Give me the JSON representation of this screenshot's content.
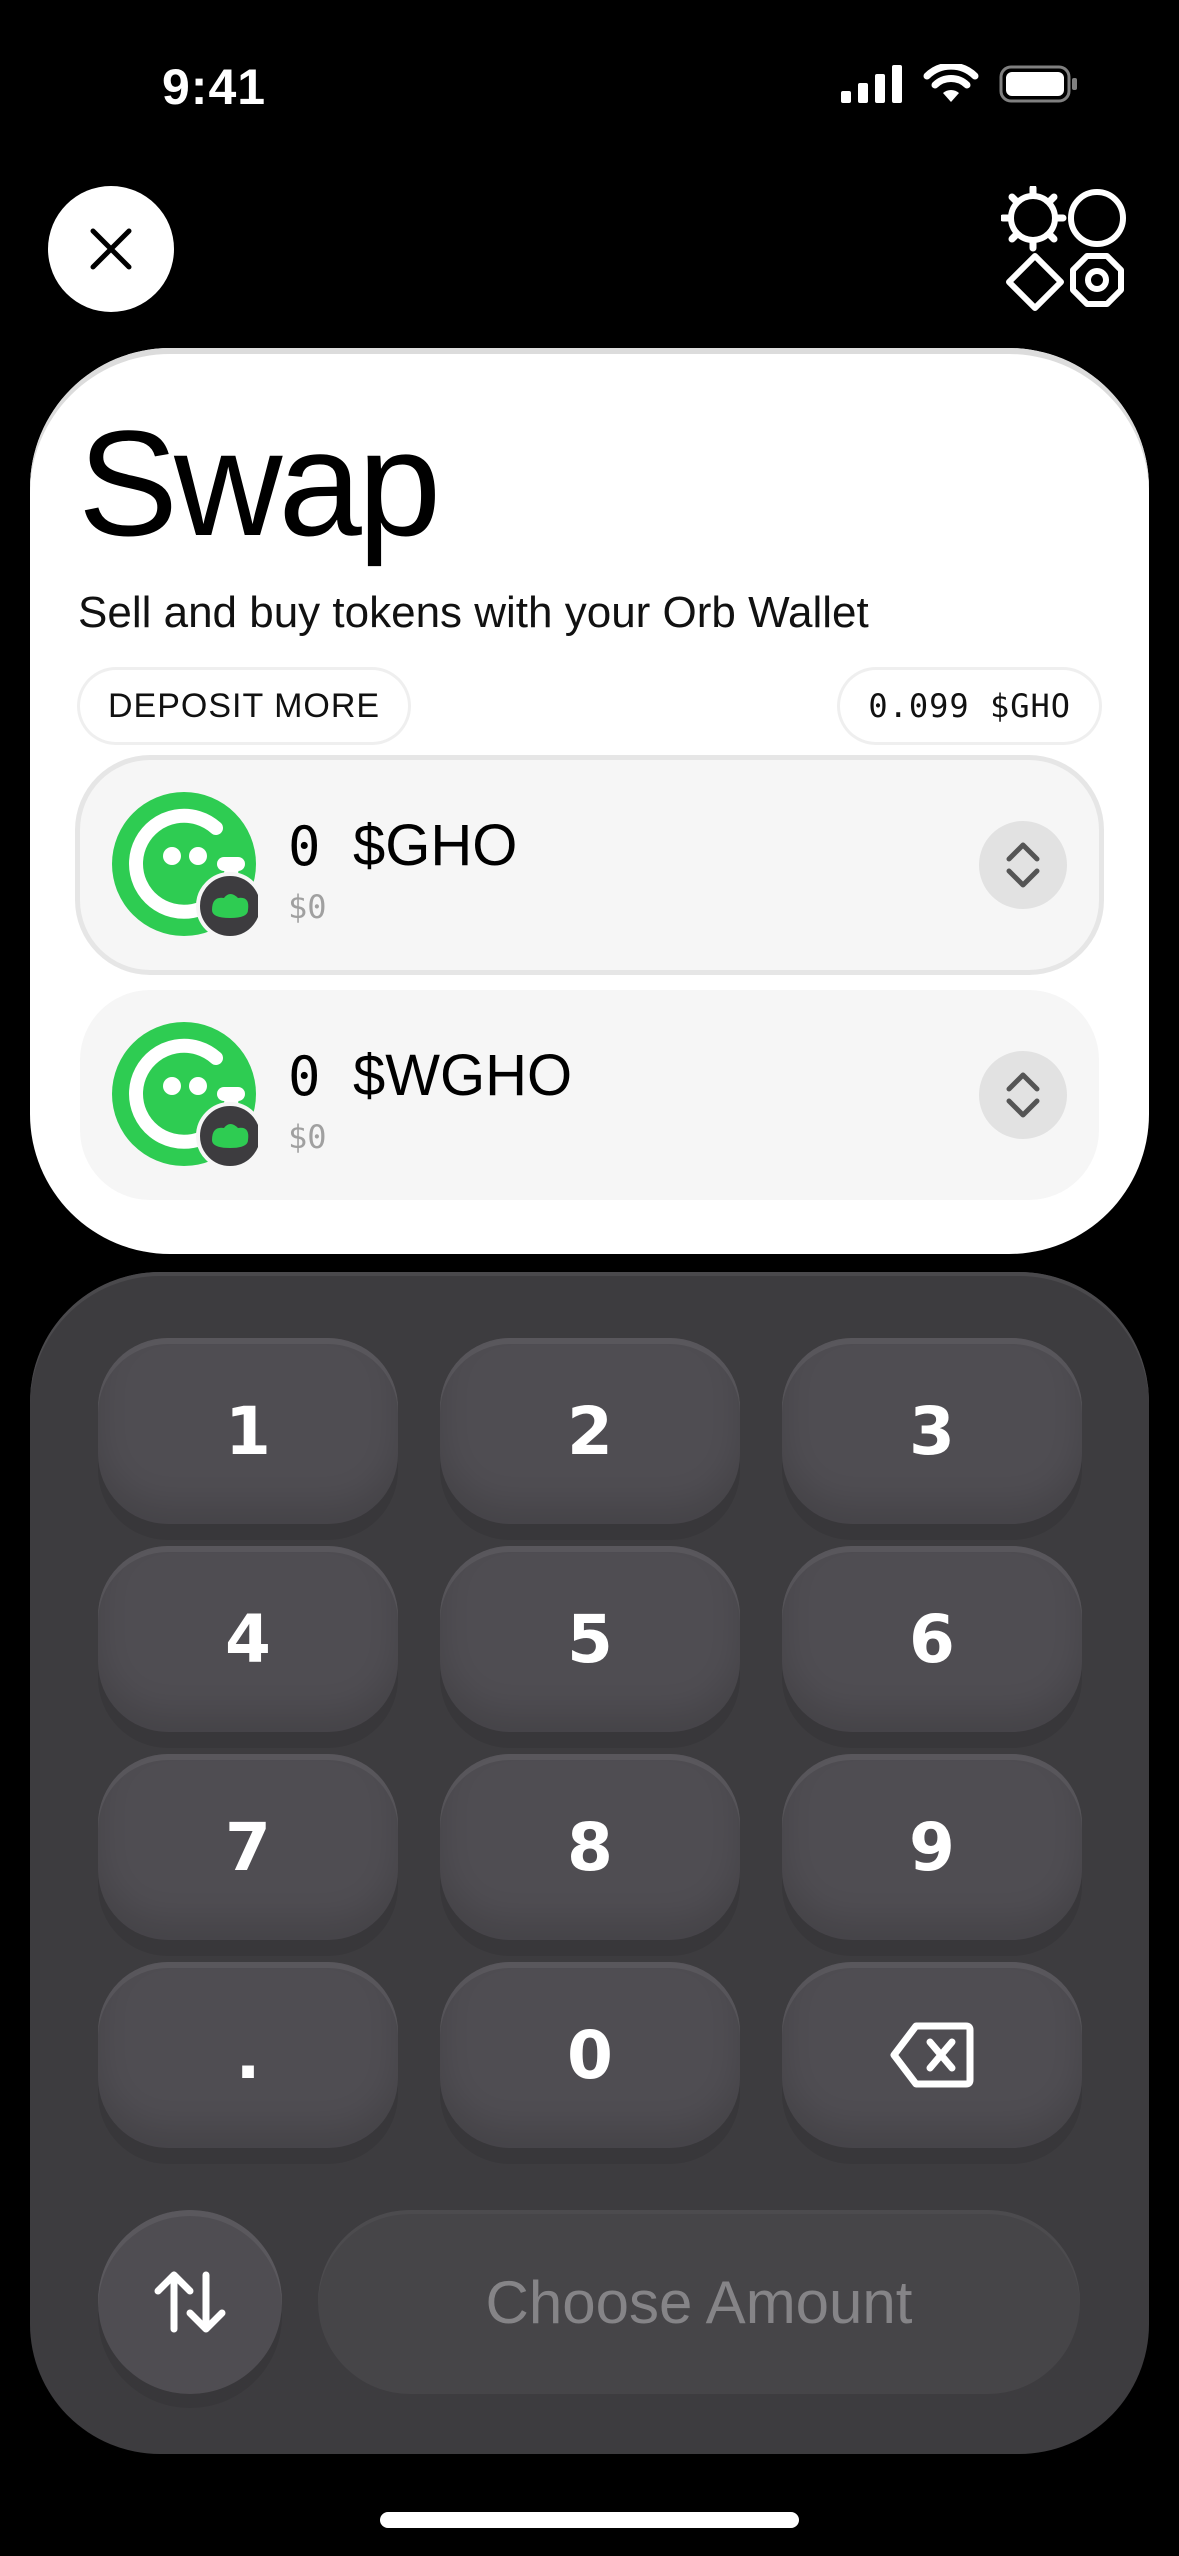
{
  "status_bar": {
    "time": "9:41"
  },
  "header": {
    "close_icon": "close-icon",
    "logo_icon": "orb-logo-icon"
  },
  "swap": {
    "title": "Swap",
    "subtitle": "Sell and buy tokens with your Orb Wallet",
    "deposit_label": "DEPOSIT MORE",
    "balance_label": "0.099 $GHO",
    "tokens": [
      {
        "amount": "0",
        "symbol": "$GHO",
        "usd": "$0",
        "color": "#2ecc52"
      },
      {
        "amount": "0",
        "symbol": "$WGHO",
        "usd": "$0",
        "color": "#2ecc52"
      }
    ]
  },
  "keypad": {
    "keys": [
      "1",
      "2",
      "3",
      "4",
      "5",
      "6",
      "7",
      "8",
      "9",
      ".",
      "0"
    ],
    "backspace_icon": "backspace-icon",
    "swap_direction_icon": "swap-arrows-icon",
    "action_label": "Choose Amount"
  },
  "colors": {
    "accent_green": "#2ecc52",
    "panel_dark": "#3d3c3f",
    "key_bg": "#4f4d52"
  }
}
